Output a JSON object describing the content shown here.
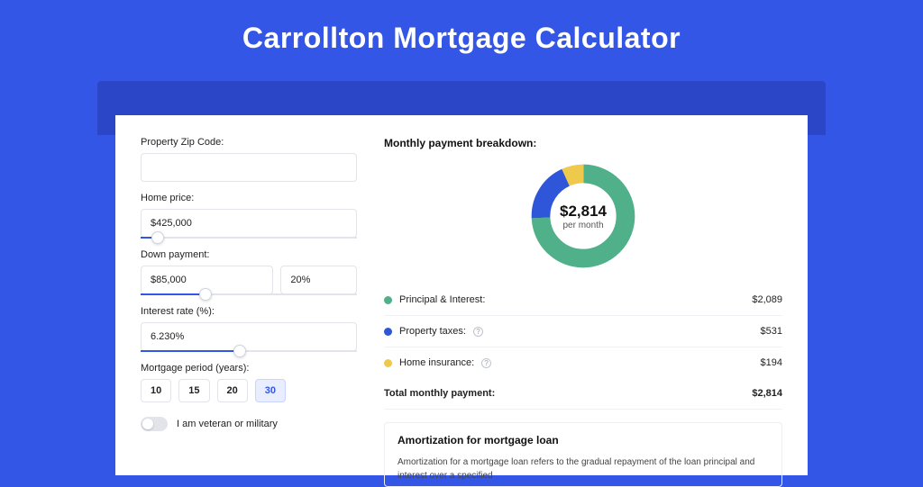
{
  "title": "Carrollton Mortgage Calculator",
  "form": {
    "zip_label": "Property Zip Code:",
    "zip_value": "",
    "home_price_label": "Home price:",
    "home_price_value": "$425,000",
    "home_price_slider_pct": 8,
    "down_label": "Down payment:",
    "down_value": "$85,000",
    "down_pct_value": "20%",
    "down_slider_pct": 30,
    "rate_label": "Interest rate (%):",
    "rate_value": "6.230%",
    "rate_slider_pct": 46,
    "period_label": "Mortgage period (years):",
    "periods": [
      "10",
      "15",
      "20",
      "30"
    ],
    "period_selected_index": 3,
    "vet_label": "I am veteran or military",
    "vet_on": false
  },
  "breakdown": {
    "title": "Monthly payment breakdown:",
    "total_display": "$2,814",
    "total_sub": "per month",
    "rows": [
      {
        "color": "green",
        "label": "Principal & Interest:",
        "help": false,
        "value": "$2,089"
      },
      {
        "color": "blue",
        "label": "Property taxes:",
        "help": true,
        "value": "$531"
      },
      {
        "color": "yellow",
        "label": "Home insurance:",
        "help": true,
        "value": "$194"
      }
    ],
    "total_label": "Total monthly payment:",
    "total_value": "$2,814"
  },
  "amortization": {
    "title": "Amortization for mortgage loan",
    "text": "Amortization for a mortgage loan refers to the gradual repayment of the loan principal and interest over a specified"
  },
  "chart_data": {
    "type": "pie",
    "title": "Monthly payment breakdown",
    "series": [
      {
        "name": "Principal & Interest",
        "value": 2089,
        "color": "#4fb08a"
      },
      {
        "name": "Property taxes",
        "value": 531,
        "color": "#2f56d8"
      },
      {
        "name": "Home insurance",
        "value": 194,
        "color": "#efc94c"
      }
    ],
    "total": 2814,
    "center_label": "$2,814",
    "center_sub": "per month"
  }
}
